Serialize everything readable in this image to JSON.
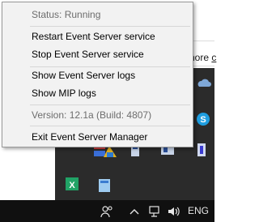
{
  "context_menu": {
    "status": "Status: Running",
    "restart": "Restart Event Server service",
    "stop": "Stop Event Server service",
    "show_logs": "Show Event Server logs",
    "show_mip_logs": "Show MIP logs",
    "version": "Version: 12.1a (Build: 4807)",
    "exit": "Exit Event Server Manager"
  },
  "background_window": {
    "text_prefix": "nore ",
    "link_text": "c"
  },
  "taskbar": {
    "language": "ENG"
  },
  "colors": {
    "menu_background": "#f2f2f2",
    "disabled_text": "#6d6d6d",
    "tray_background": "#2b2b2b",
    "taskbar_background": "#101010"
  },
  "icons": [
    "cloud-icon",
    "skype-icon",
    "server-icon",
    "graphics-icon",
    "shield-icon",
    "drive-icon",
    "usb-icon",
    "milestone-icon",
    "excel-icon",
    "app-icon",
    "people-icon",
    "chevron-up-icon",
    "network-icon",
    "volume-icon"
  ]
}
